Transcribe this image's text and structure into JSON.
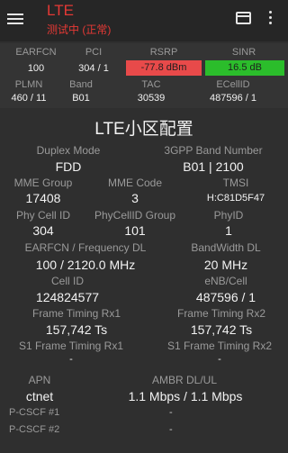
{
  "appbar": {
    "title": "LTE",
    "subtitle": "测试中 (正常)"
  },
  "top_grid": {
    "headers_row1": [
      "EARFCN",
      "PCI",
      "RSRP",
      "SINR"
    ],
    "earfcn": "100",
    "pci": "304 / 1",
    "rsrp": "-77.8 dBm",
    "sinr": "16.5 dB",
    "headers_row2": [
      "PLMN",
      "Band",
      "TAC",
      "ECellID"
    ],
    "plmn": "460 / 11",
    "band": "B01",
    "tac": "30539",
    "ecellid": "487596 / 1",
    "colors": {
      "rsrp_bg": "#e84a4a",
      "sinr_bg": "#2bbd2b"
    }
  },
  "section": {
    "title": "LTE小区配置",
    "duplex_mode_label": "Duplex Mode",
    "duplex_mode": "FDD",
    "gpp_band_label": "3GPP Band Number",
    "gpp_band": "B01 | 2100",
    "mme_group_label": "MME Group",
    "mme_group": "17408",
    "mme_code_label": "MME Code",
    "mme_code": "3",
    "tmsi_label": "TMSI",
    "tmsi": "H:C81D5F47",
    "phy_cell_id_label": "Phy Cell ID",
    "phy_cell_id": "304",
    "phy_cellid_group_label": "PhyCellID Group",
    "phy_cellid_group": "101",
    "phyid_label": "PhyID",
    "phyid": "1",
    "earfcn_freq_label": "EARFCN / Frequency DL",
    "earfcn_freq": "100 / 2120.0 MHz",
    "bandwidth_label": "BandWidth DL",
    "bandwidth": "20 MHz",
    "cell_id_label": "Cell ID",
    "cell_id": "124824577",
    "enb_cell_label": "eNB/Cell",
    "enb_cell": "487596 / 1",
    "frame_rx1_label": "Frame Timing Rx1",
    "frame_rx1": "157,742 Ts",
    "frame_rx2_label": "Frame Timing Rx2",
    "frame_rx2": "157,742 Ts",
    "s1_rx1_label": "S1 Frame Timing Rx1",
    "s1_rx1": "-",
    "s1_rx2_label": "S1 Frame Timing Rx2",
    "s1_rx2": "-",
    "apn_label": "APN",
    "apn": "ctnet",
    "ambr_label": "AMBR DL/UL",
    "ambr": "1.1 Mbps / 1.1 Mbps",
    "pcscf1_label": "P-CSCF #1",
    "pcscf1": "-",
    "pcscf2_label": "P-CSCF #2",
    "pcscf2": "-"
  },
  "icons": [
    "menu-icon",
    "sim-card-icon",
    "more-vert-icon"
  ]
}
